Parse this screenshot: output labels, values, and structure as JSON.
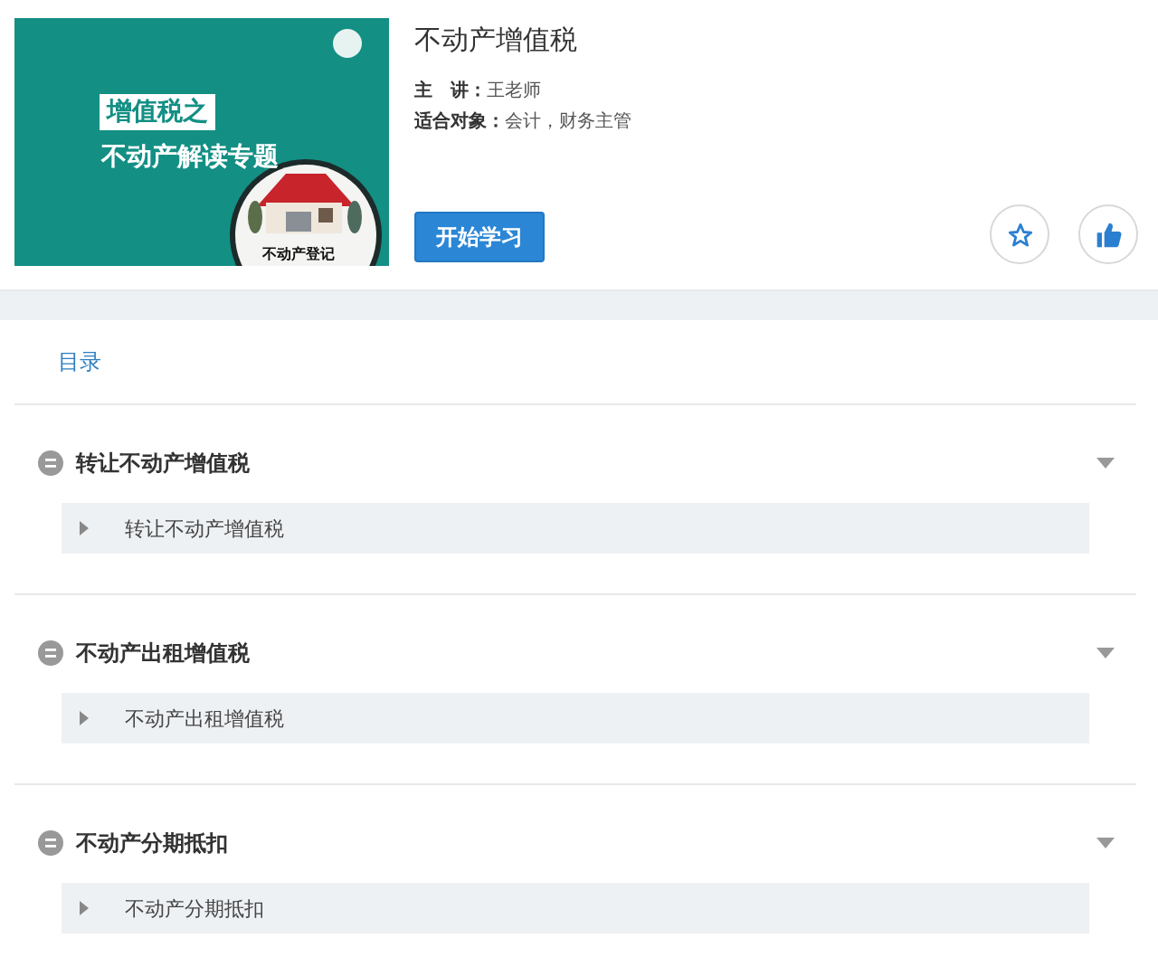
{
  "course": {
    "cover": {
      "kind": "picture",
      "headline": "增值税之",
      "subline": "不动产解读专题",
      "badge": "不动产登记"
    },
    "title": "不动产增值税",
    "meta": [
      {
        "label": "主　讲：",
        "value": "王老师"
      },
      {
        "label": "适合对象：",
        "value": "会计，财务主管"
      }
    ],
    "start_button": "开始学习"
  },
  "toc": {
    "heading": "目录",
    "chapters": [
      {
        "title": "转让不动产增值税",
        "expanded": true,
        "lessons": [
          "转让不动产增值税"
        ]
      },
      {
        "title": "不动产出租增值税",
        "expanded": true,
        "lessons": [
          "不动产出租增值税"
        ]
      },
      {
        "title": "不动产分期抵扣",
        "expanded": true,
        "lessons": [
          "不动产分期抵扣"
        ]
      }
    ]
  }
}
